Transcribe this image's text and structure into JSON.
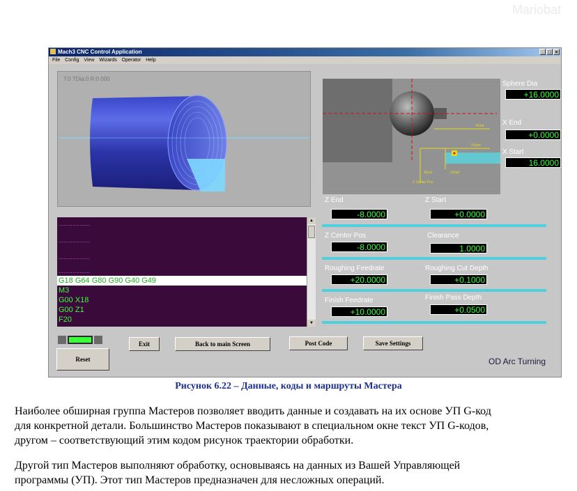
{
  "watermark": "Mariobat",
  "window": {
    "title": "Mach3 CNC Control Application",
    "controls": [
      "_",
      "□",
      "×"
    ]
  },
  "menu": [
    "File",
    "Config",
    "View",
    "Wizards",
    "Operator",
    "Help"
  ],
  "toolpath": {
    "tool_info": "T:0 TDia:0 R:0.000"
  },
  "gcode": {
    "placeholder_lines": [
      "..................",
      "..................",
      "..................",
      ".................."
    ],
    "selected_line": "G18 G64 G80 G90 G40 G49",
    "lines": [
      "M3",
      "G00 X18",
      "G00 Z1",
      "F20"
    ]
  },
  "preview": {
    "labels": {
      "xend": "XEnd",
      "xstart": "XStart",
      "zend": "ZEnd",
      "zstart": "ZStart",
      "zcenter": "Z Center Pos"
    }
  },
  "fields": {
    "sphere_dia": {
      "label": "Sphere Dia",
      "value": "+16.0000"
    },
    "x_end": {
      "label": "X End",
      "value": "+0.0000"
    },
    "x_start": {
      "label": "X Start",
      "value": "16.0000"
    },
    "z_end": {
      "label": "Z End",
      "value": "-8.0000"
    },
    "z_start": {
      "label": "Z Start",
      "value": "+0.0000"
    },
    "z_center_pos": {
      "label": "Z Center Pos",
      "value": "-8.0000"
    },
    "clearance": {
      "label": "Clearance",
      "value": "1.0000"
    },
    "roughing_feedrate": {
      "label": "Roughing Feedrate",
      "value": "+20.0000"
    },
    "roughing_cut_depth": {
      "label": "Roughing Cut Depth",
      "value": "+0.1000"
    },
    "finish_feedrate": {
      "label": "Finish Feedrate",
      "value": "+10.0000"
    },
    "finish_pass_depth": {
      "label": "Finish Pass Depth",
      "value": "+0.0500"
    }
  },
  "buttons": {
    "reset": "Reset",
    "exit": "Exit",
    "back": "Back to main Screen",
    "post": "Post Code",
    "save": "Save Settings"
  },
  "wizard_name": "OD Arc Turning",
  "caption": "Рисунок 6.22 – Данные, коды и маршруты Мастера",
  "paragraphs": [
    [
      "Наиболее обширная группа Мастеров позволяет вводить данные и создавать на их основе УП G-код",
      "для конкретной детали. Большинство Мастеров показывают в специальном окне текст УП G-кодов,",
      "другом – соответствующий этим кодом рисунок траектории обработки."
    ],
    [
      "Другой тип Мастеров выполняют обработку, основываясь на данных из Вашей Управляющей",
      "программы (УП). Этот тип Мастеров предназначен для несложных операций."
    ]
  ]
}
